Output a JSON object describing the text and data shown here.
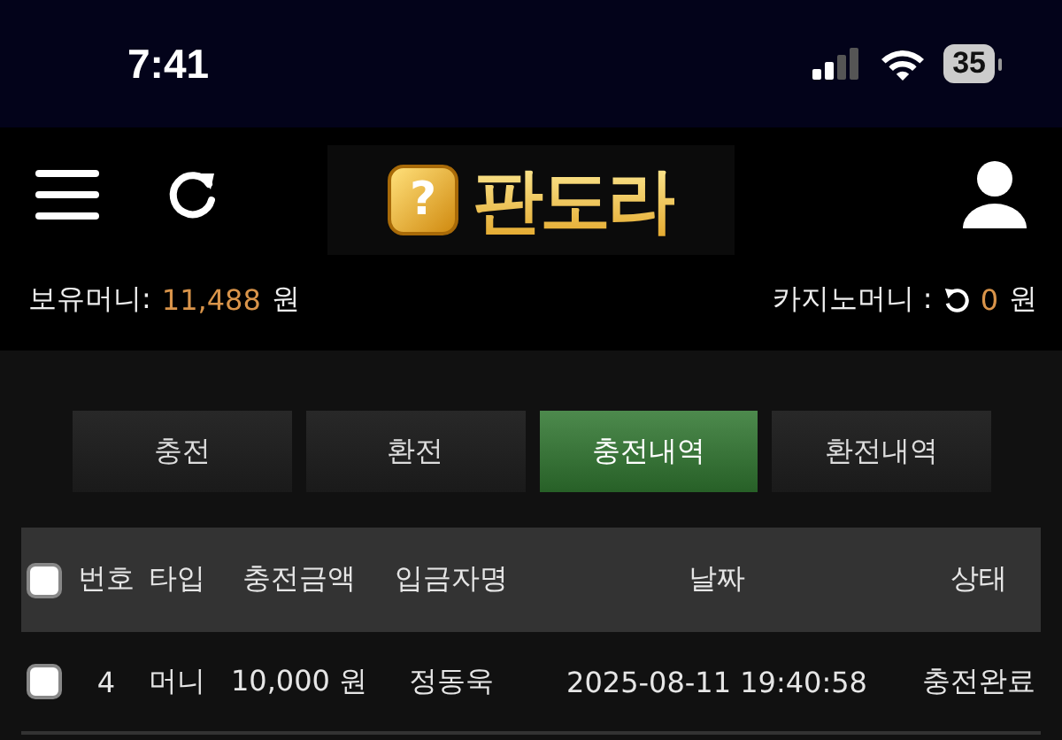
{
  "status_bar": {
    "time": "7:41",
    "battery": "35"
  },
  "header": {
    "logo_mark": "?",
    "logo_text": "판도라"
  },
  "balance": {
    "label": "보유머니:",
    "amount": "11,488",
    "unit": "원",
    "casino_label": "카지노머니 :",
    "casino_amount": "0",
    "casino_unit": "원"
  },
  "tabs": [
    {
      "label": "충전",
      "selected": false
    },
    {
      "label": "환전",
      "selected": false
    },
    {
      "label": "충전내역",
      "selected": true
    },
    {
      "label": "환전내역",
      "selected": false
    }
  ],
  "table": {
    "select_all_checked": false,
    "columns": [
      "번호",
      "타입",
      "충전금액",
      "입금자명",
      "날짜",
      "상태"
    ],
    "rows": [
      {
        "checked": false,
        "cells": [
          "4",
          "머니",
          "10,000 원",
          "정동욱",
          "2025-08-11 19:40:58",
          "충전완료"
        ]
      }
    ]
  }
}
